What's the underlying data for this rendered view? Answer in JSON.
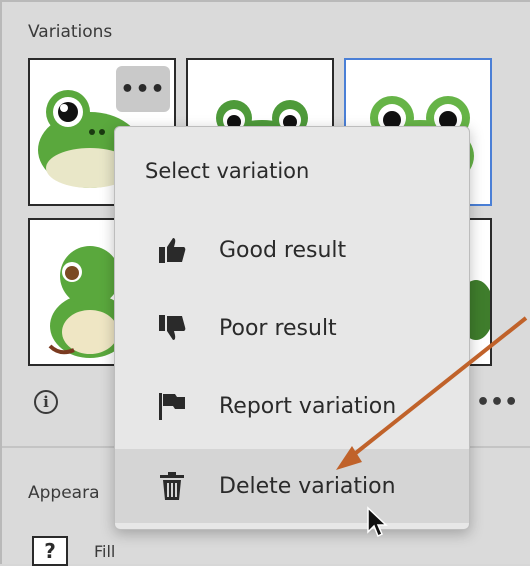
{
  "panel": {
    "variations_title": "Variations",
    "appearance_label": "Appeara",
    "fill_label": "Fill",
    "fill_swatch_glyph": "?",
    "info_glyph": "i",
    "more_glyph": "•••",
    "more_right_glyph": "•••"
  },
  "menu": {
    "title": "Select variation",
    "items": [
      {
        "label": "Good result",
        "icon": "thumbs-up-icon"
      },
      {
        "label": "Poor result",
        "icon": "thumbs-down-icon"
      },
      {
        "label": "Report variation",
        "icon": "flag-icon"
      },
      {
        "label": "Delete variation",
        "icon": "trash-icon"
      }
    ]
  },
  "colors": {
    "accent_selected": "#4a7fd6",
    "annotation_arrow": "#c0622a",
    "frog_green": "#5aa83d"
  }
}
